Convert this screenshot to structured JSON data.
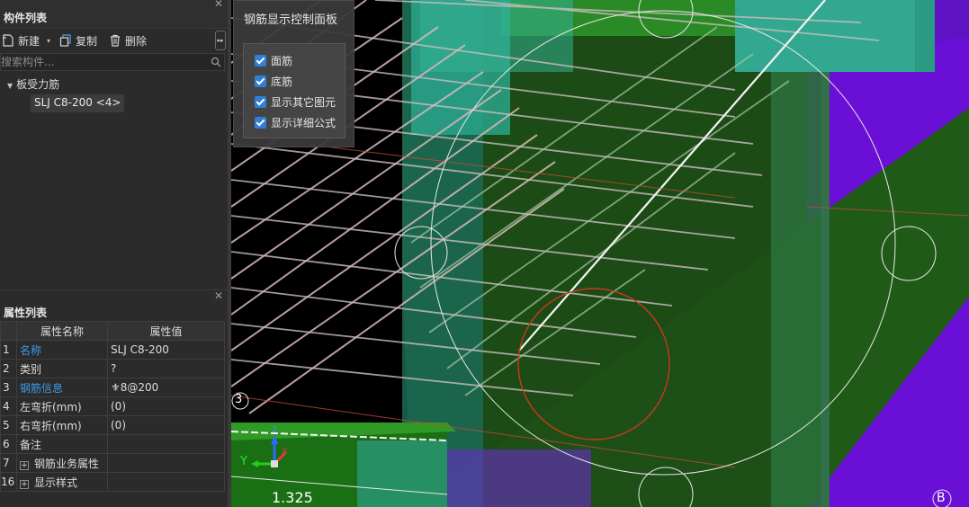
{
  "component_panel": {
    "title": "构件列表",
    "toolbar": {
      "new_label": "新建",
      "copy_label": "复制",
      "delete_label": "删除",
      "collapse_label": "▸▸"
    },
    "search": {
      "placeholder": "搜索构件...",
      "value": ""
    },
    "tree": {
      "group_label": "板受力筋",
      "selected_item": "SLJ C8-200 <4>"
    }
  },
  "property_panel": {
    "title": "属性列表",
    "columns": [
      "属性名称",
      "属性值"
    ],
    "rows": [
      {
        "idx": "1",
        "name": "名称",
        "value": "SLJ C8-200"
      },
      {
        "idx": "2",
        "name": "类别",
        "value": "?"
      },
      {
        "idx": "3",
        "name": "钢筋信息",
        "value": "⚜8@200"
      },
      {
        "idx": "4",
        "name": "左弯折(mm)",
        "value": "(0)"
      },
      {
        "idx": "5",
        "name": "右弯折(mm)",
        "value": "(0)"
      },
      {
        "idx": "6",
        "name": "备注",
        "value": ""
      },
      {
        "idx": "7",
        "name": "钢筋业务属性",
        "value": ""
      },
      {
        "idx": "16",
        "name": "显示样式",
        "value": ""
      }
    ]
  },
  "control_panel": {
    "title": "钢筋显示控制面板",
    "options": [
      {
        "label": "面筋",
        "checked": true
      },
      {
        "label": "底筋",
        "checked": true
      },
      {
        "label": "显示其它图元",
        "checked": true
      },
      {
        "label": "显示详细公式",
        "checked": true
      }
    ]
  },
  "viewport": {
    "axis_marker_left": "3",
    "axis_marker_right": "B",
    "dimension_label": "1.325",
    "axis_y": "Y",
    "axis_x": "X",
    "axis_z": "Z"
  },
  "colors": {
    "accent_blue": "#3d9be8",
    "checkbox_blue": "#2f7fd8",
    "purple": "#6a0fd6",
    "green": "#1f6b1a",
    "cyan": "#2fa78e"
  }
}
